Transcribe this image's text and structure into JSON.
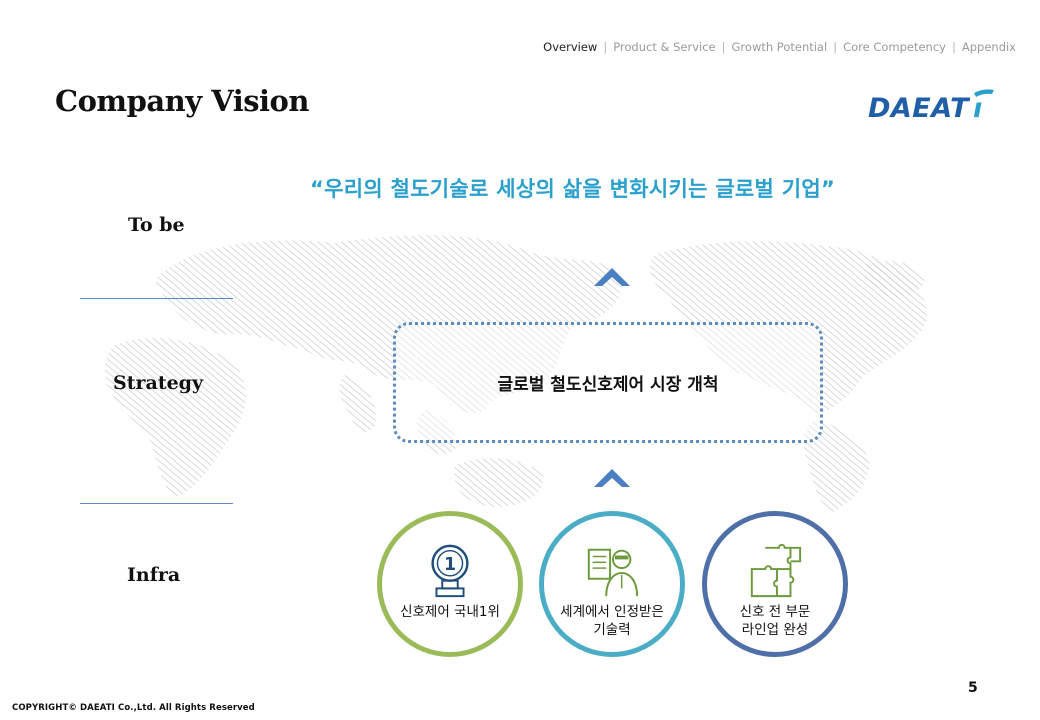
{
  "nav": {
    "items": [
      {
        "label": "Overview",
        "active": true
      },
      {
        "label": "Product & Service",
        "active": false
      },
      {
        "label": "Growth Potential",
        "active": false
      },
      {
        "label": "Core Competency",
        "active": false
      },
      {
        "label": "Appendix",
        "active": false
      }
    ],
    "separator": "|"
  },
  "title": "Company Vision",
  "logo": {
    "text": "DAEATi",
    "color": "#1f5fa8",
    "accent": "#2aa0cd"
  },
  "slogan": "“우리의 철도기술로 세상의 삶을 변화시키는 글로벌 기업”",
  "rows": {
    "tobe": "To be",
    "strategy": "Strategy",
    "infra": "Infra"
  },
  "strategy_box": {
    "text": "글로벌 철도신호제어 시장 개척"
  },
  "infra_items": [
    {
      "line1": "신호제어 국내1위",
      "line2": "",
      "icon": "medal-number-one-icon",
      "color": "#9bbb59"
    },
    {
      "line1": "세계에서 인정받은",
      "line2": "기술력",
      "icon": "engineer-checklist-icon",
      "color": "#4bacc6"
    },
    {
      "line1": "신호 전 부문",
      "line2": "라인업 완성",
      "icon": "puzzle-pieces-icon",
      "color": "#4f6fa8"
    }
  ],
  "page_number": "5",
  "copyright": "COPYRIGHT© DAEATI Co.,Ltd. All Rights Reserved",
  "colors": {
    "accent_blue": "#2aa0cd",
    "divider": "#5b8bbf",
    "arrow": "#4a7fc1"
  }
}
